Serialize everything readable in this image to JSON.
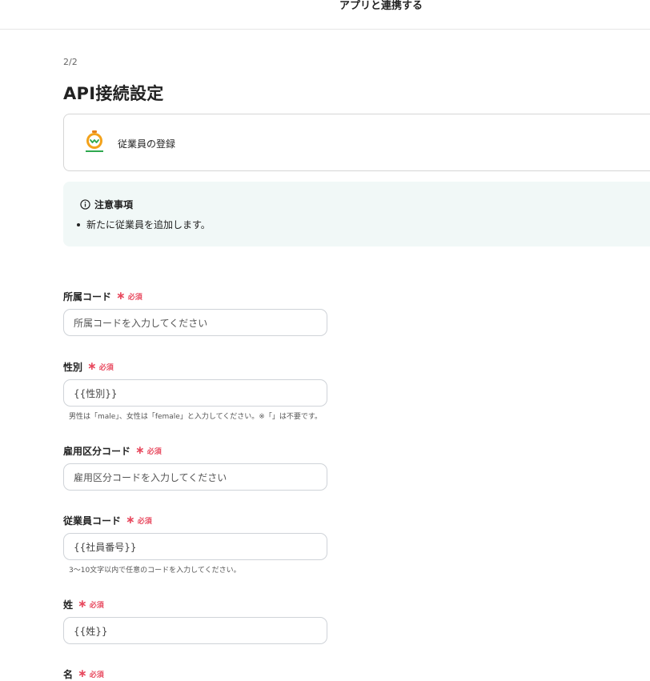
{
  "header": {
    "title": "アプリと連携する"
  },
  "step": "2/2",
  "page_title": "API接続設定",
  "action": {
    "app_logo_icon": "hrmos-logo-icon",
    "label": "従業員の登録"
  },
  "notice": {
    "title": "注意事項",
    "icon": "info-icon",
    "items": [
      "新たに従業員を追加します。"
    ]
  },
  "required_label": "必須",
  "colors": {
    "required": "#e84a5f",
    "notice_bg": "#f1f8f7"
  },
  "fields": [
    {
      "label": "所属コード",
      "value": "",
      "placeholder": "所属コードを入力してください",
      "help": ""
    },
    {
      "label": "性別",
      "value": "{{性別}}",
      "placeholder": "",
      "help": "男性は「male」、女性は「female」と入力してください。※「」は不要です。"
    },
    {
      "label": "雇用区分コード",
      "value": "",
      "placeholder": "雇用区分コードを入力してください",
      "help": ""
    },
    {
      "label": "従業員コード",
      "value": "{{社員番号}}",
      "placeholder": "",
      "help": "3～10文字以内で任意のコードを入力してください。"
    },
    {
      "label": "姓",
      "value": "{{姓}}",
      "placeholder": "",
      "help": ""
    },
    {
      "label": "名",
      "value": "",
      "placeholder": "",
      "help": ""
    }
  ]
}
